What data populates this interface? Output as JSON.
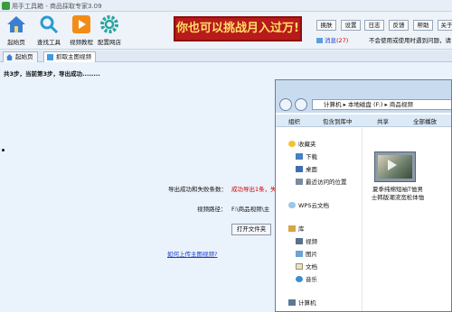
{
  "window": {
    "title": "用手工具箱 - 商品採取专家3.09"
  },
  "toolbar": {
    "items": [
      {
        "label": "起始页",
        "icon": "home-icon"
      },
      {
        "label": "查找工具",
        "icon": "search-icon"
      },
      {
        "label": "视频教程",
        "icon": "play-icon"
      },
      {
        "label": "配置网店",
        "icon": "gear-icon"
      }
    ]
  },
  "banner": {
    "text": "你也可以挑战月入过万!"
  },
  "top_buttons": [
    "换肤",
    "设置",
    "日志",
    "反馈",
    "帮助",
    "关于"
  ],
  "messages": {
    "label": "消息",
    "count": "(27)"
  },
  "notice": "不会使用或使用时遇到问题，请",
  "tabs": [
    {
      "label": "起始页"
    },
    {
      "label": "抓取主图视频"
    }
  ],
  "main": {
    "step_text": "共3步，当前第3步，导出成功........",
    "export_label": "导出成功和失败条数：",
    "export_value": "成功导出1条，失",
    "path_label": "视频路径：",
    "path_value": "F:\\商品视频\\主",
    "open_folder_button": "打开文件夹",
    "upload_link": "如何上传主图视频?"
  },
  "explorer": {
    "address": [
      "计算机",
      "本地磁盘 (F:)",
      "商品视频"
    ],
    "toolbar": [
      "组织",
      "包含到库中",
      "共享",
      "全部播放"
    ],
    "nav": {
      "favorites": "收藏夹",
      "favorites_items": [
        "下载",
        "桌面",
        "最近访问的位置"
      ],
      "wps": "WPS云文档",
      "libraries": "库",
      "library_items": [
        "视频",
        "图片",
        "文档",
        "音乐"
      ],
      "computer": "计算机"
    },
    "file": {
      "name": "夏季纯棉短袖T恤男士韩版潮流宽松体恤"
    }
  },
  "colors": {
    "banner_bg": "#b81b1b",
    "banner_text": "#ffe066",
    "alert_text": "#d10000",
    "link": "#1a3fd0"
  }
}
